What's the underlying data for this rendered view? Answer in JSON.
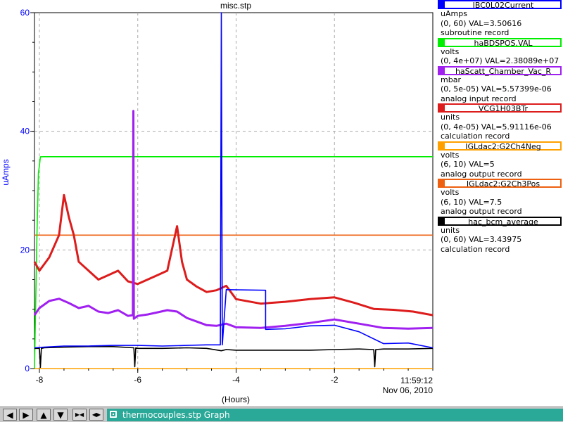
{
  "chart_data": {
    "type": "line",
    "title": "misc.stp",
    "ylabel": "uAmps",
    "xlabel": "(Hours)",
    "xlim": [
      -8.1,
      0.0
    ],
    "ylim": [
      0,
      60
    ],
    "x_ticks": [
      -8,
      -6,
      -4,
      -2
    ],
    "y_ticks": [
      0,
      20,
      40,
      60
    ],
    "grid": true,
    "time_label": "11:59:12",
    "date_label": "Nov 06, 2010",
    "series": [
      {
        "name": "IBC0L02Current",
        "color": "#0000ff",
        "range": [
          0,
          60
        ],
        "x": [
          -8.1,
          -7.9,
          -7.5,
          -7.0,
          -6.5,
          -6.0,
          -5.5,
          -5.0,
          -4.6,
          -4.32,
          -4.3,
          -4.28,
          -4.2,
          -3.4,
          -3.4,
          -3.0,
          -2.5,
          -2.0,
          -1.5,
          -1.0,
          -0.5,
          0.0
        ],
        "y": [
          3.5,
          3.6,
          3.8,
          3.8,
          3.9,
          3.9,
          3.8,
          3.9,
          4.0,
          4.0,
          60,
          4.0,
          13.3,
          13.2,
          6.6,
          6.7,
          7.2,
          7.3,
          6.2,
          4.2,
          4.3,
          3.5
        ]
      },
      {
        "name": "haBDSPOS.VAL",
        "color": "#00ee00",
        "range": [
          0,
          40000000
        ],
        "x": [
          -8.1,
          -8.05,
          -8.02,
          -8.0,
          -7.98,
          -7.9,
          0.0
        ],
        "y": [
          0,
          15000000,
          22000000,
          22800000,
          23800000,
          23808900,
          23808900
        ]
      },
      {
        "name": "haScatt_Chamber_Vac_R",
        "color": "#a020f0",
        "range": [
          0,
          5e-05
        ],
        "x": [
          -8.1,
          -8.0,
          -7.8,
          -7.6,
          -7.4,
          -7.2,
          -7.0,
          -6.8,
          -6.6,
          -6.4,
          -6.2,
          -6.1,
          -6.09,
          -6.08,
          -6.0,
          -5.8,
          -5.6,
          -5.4,
          -5.2,
          -5.0,
          -4.8,
          -4.6,
          -4.4,
          -4.2,
          -4.0,
          -3.5,
          -3.0,
          -2.5,
          -2.0,
          -1.5,
          -1.0,
          -0.5,
          0.0
        ],
        "y": [
          7.5e-06,
          8.5e-06,
          9.5e-06,
          9.8e-06,
          9.2e-06,
          8.5e-06,
          8.8e-06,
          8e-06,
          7.8e-06,
          8.2e-06,
          7.4e-06,
          7.5e-06,
          3.62e-05,
          7e-06,
          7.4e-06,
          7.6e-06,
          7.9e-06,
          8.2e-06,
          8e-06,
          7.1e-06,
          6.6e-06,
          6.1e-06,
          6e-06,
          6.3e-06,
          5.8e-06,
          5.7e-06,
          6e-06,
          6.4e-06,
          6.9e-06,
          6.3e-06,
          5.7e-06,
          5.6e-06,
          5.7e-06
        ]
      },
      {
        "name": "VCG1H03BTr",
        "color": "#dd1c1c",
        "range": [
          0,
          4e-05
        ],
        "x": [
          -8.1,
          -8.0,
          -7.8,
          -7.6,
          -7.5,
          -7.4,
          -7.3,
          -7.2,
          -7.0,
          -6.8,
          -6.6,
          -6.4,
          -6.2,
          -6.0,
          -5.8,
          -5.6,
          -5.4,
          -5.2,
          -5.1,
          -5.0,
          -4.8,
          -4.6,
          -4.4,
          -4.2,
          -4.0,
          -3.5,
          -3.0,
          -2.5,
          -2.0,
          -1.6,
          -1.2,
          -0.8,
          -0.4,
          0.0
        ],
        "y": [
          1.2e-05,
          1.1e-05,
          1.25e-05,
          1.5e-05,
          1.95e-05,
          1.7e-05,
          1.5e-05,
          1.2e-05,
          1.1e-05,
          1e-05,
          1.05e-05,
          1.1e-05,
          9.8e-06,
          9.5e-06,
          1e-05,
          1.05e-05,
          1.1e-05,
          1.6e-05,
          1.2e-05,
          1e-05,
          9.2e-06,
          8.6e-06,
          8.8e-06,
          9.3e-06,
          7.8e-06,
          7.3e-06,
          7.5e-06,
          7.8e-06,
          8e-06,
          7.4e-06,
          6.7e-06,
          6.6e-06,
          6.4e-06,
          6e-06
        ]
      },
      {
        "name": "IGLdac2:G2Ch4Neg",
        "color": "#ffa000",
        "range": [
          6,
          10
        ],
        "x": [
          -8.1,
          0.0
        ],
        "y": [
          5,
          5
        ]
      },
      {
        "name": "IGLdac2:G2Ch3Pos",
        "color": "#ee6010",
        "range": [
          6,
          10
        ],
        "x": [
          -8.1,
          0.0
        ],
        "y": [
          7.5,
          7.5
        ]
      },
      {
        "name": "hac_bcm_average",
        "color": "#000000",
        "range": [
          0,
          60
        ],
        "x": [
          -8.1,
          -8.0,
          -7.98,
          -7.96,
          -7.9,
          -7.5,
          -7.0,
          -6.5,
          -6.08,
          -6.06,
          -6.04,
          -6.0,
          -5.5,
          -5.0,
          -4.6,
          -4.3,
          -4.2,
          -4.0,
          -3.5,
          -3.0,
          -2.5,
          -2.0,
          -1.5,
          -1.2,
          -1.18,
          -1.16,
          -1.0,
          -0.5,
          0.0
        ],
        "y": [
          3.4,
          3.4,
          0.2,
          3.4,
          3.5,
          3.6,
          3.7,
          3.7,
          3.5,
          0.3,
          3.5,
          3.4,
          3.4,
          3.5,
          3.4,
          3.0,
          3.2,
          3.1,
          3.1,
          3.1,
          3.1,
          3.2,
          3.3,
          3.2,
          0.3,
          3.2,
          3.3,
          3.3,
          3.4
        ]
      }
    ]
  },
  "legend": [
    {
      "name": "IBC0L02Current",
      "unit": "uAmps",
      "value_line": "(0, 60) VAL=3.50616",
      "record": "subroutine record",
      "color": "#0000ff"
    },
    {
      "name": "haBDSPOS.VAL",
      "unit": "volts",
      "value_line": "(0, 4e+07) VAL=2.38089e+07",
      "record": "",
      "color": "#00ee00"
    },
    {
      "name": "haScatt_Chamber_Vac_R",
      "unit": "mbar",
      "value_line": "(0, 5e-05) VAL=5.57399e-06",
      "record": "analog input record",
      "color": "#a020f0"
    },
    {
      "name": "VCG1H03BTr",
      "unit": "units",
      "value_line": "(0, 4e-05) VAL=5.91116e-06",
      "record": "calculation record",
      "color": "#dd1c1c"
    },
    {
      "name": "IGLdac2:G2Ch4Neg",
      "unit": "volts",
      "value_line": "(6, 10) VAL=5",
      "record": "analog output record",
      "color": "#ffa000"
    },
    {
      "name": "IGLdac2:G2Ch3Pos",
      "unit": "volts",
      "value_line": "(6, 10) VAL=7.5",
      "record": "analog output record",
      "color": "#ee6010"
    },
    {
      "name": "hac_bcm_average",
      "unit": "units",
      "value_line": "(0, 60) VAL=3.43975",
      "record": "calculation record",
      "color": "#000000"
    }
  ],
  "taskbar": {
    "buttons": [
      {
        "name": "left-arrow-button",
        "glyph": "◀"
      },
      {
        "name": "right-arrow-button",
        "glyph": "▶"
      },
      {
        "name": "up-arrow-button",
        "glyph": "▲"
      },
      {
        "name": "down-arrow-button",
        "glyph": "▼"
      },
      {
        "name": "zoom-in-button",
        "glyph": "▶◀"
      },
      {
        "name": "zoom-out-button",
        "glyph": "◀▶"
      }
    ],
    "window_title": "thermocouples.stp Graph"
  }
}
